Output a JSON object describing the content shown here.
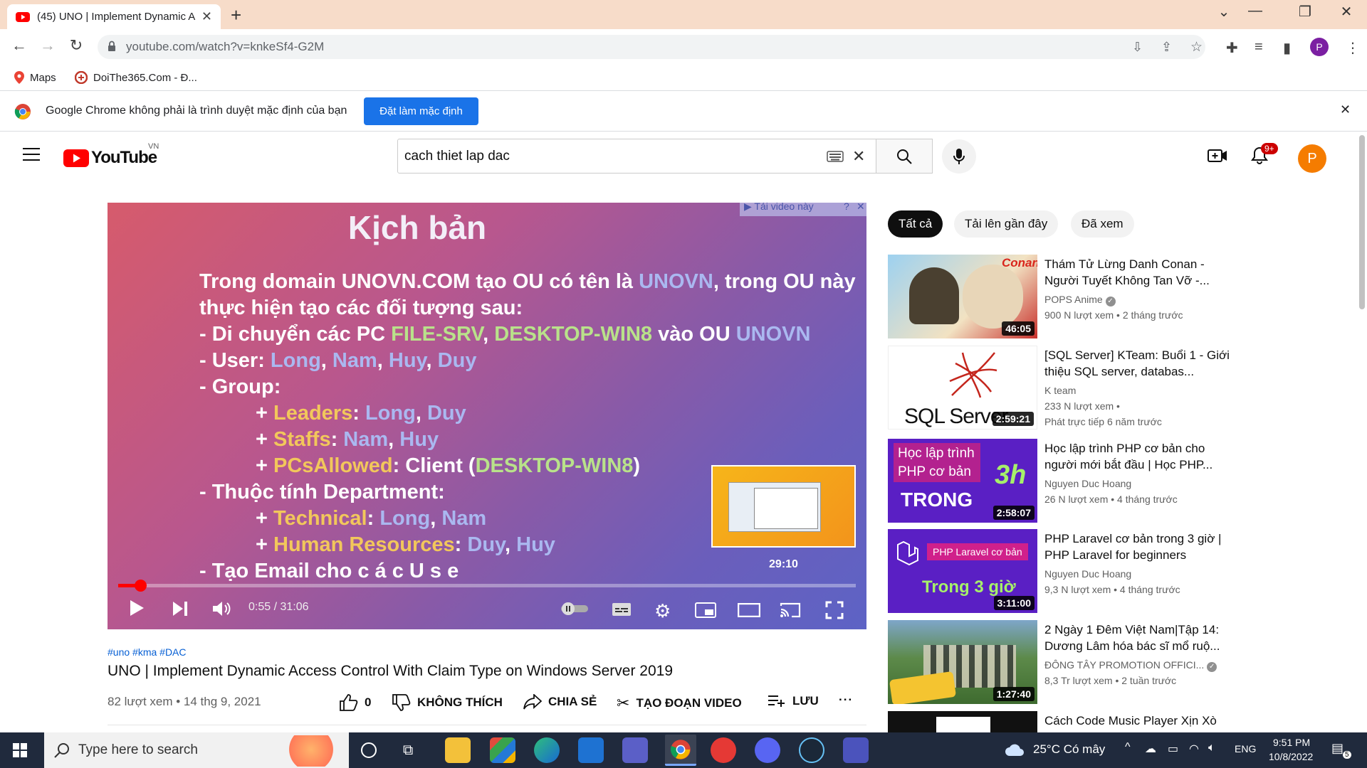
{
  "browser": {
    "tab_title": "(45) UNO | Implement Dynamic A",
    "url": "youtube.com/watch?v=knkeSf4-G2M",
    "bookmarks": [
      "Maps",
      "DoiThe365.Com - Đ..."
    ],
    "infobar_text": "Google Chrome không phải là trình duyệt mặc định của bạn",
    "infobar_button": "Đặt làm mặc định",
    "profile_initial": "P"
  },
  "youtube": {
    "logo_text": "YouTube",
    "country": "VN",
    "search_value": "cach thiet lap dac",
    "notification_count": "9+",
    "avatar_initial": "P"
  },
  "player": {
    "overlay_label": "▶ Tải video này",
    "slide_title": "Kịch bản",
    "preview_time": "29:10",
    "time": "0:55 / 31:06",
    "progress": 0.0295,
    "slide_lines": {
      "l1a": "Trong domain UNOVN.COM tạo OU có tên là ",
      "l1b": "UNOVN",
      "l1c": ", trong OU này",
      "l2": "thực hiện tạo các đối tượng sau:",
      "l3a": "- Di chuyển các PC ",
      "l3b": "FILE-SRV",
      "l3c": ", ",
      "l3d": "DESKTOP-WIN8",
      "l3e": " vào OU ",
      "l3f": "UNOVN",
      "l4a": "- User: ",
      "l4b": "Long",
      "l4c": ", ",
      "l4d": "Nam",
      "l4e": ", ",
      "l4f": "Huy",
      "l4g": ", ",
      "l4h": "Duy",
      "l5": "- Group:",
      "l6a": "+ ",
      "l6b": "Leaders",
      "l6c": ": ",
      "l6d": "Long",
      "l6e": ", ",
      "l6f": "Duy",
      "l7a": "+ ",
      "l7b": "Staffs",
      "l7c": ": ",
      "l7d": "Nam",
      "l7e": ", ",
      "l7f": "Huy",
      "l8a": "+ ",
      "l8b": "PCsAllowed",
      "l8c": ": Client (",
      "l8d": "DESKTOP-WIN8",
      "l8e": ")",
      "l9": "- Thuộc tính Department:",
      "l10a": "+ ",
      "l10b": "Technical",
      "l10c": ": ",
      "l10d": "Long",
      "l10e": ", ",
      "l10f": "Nam",
      "l11a": "+ ",
      "l11b": "Human Resources",
      "l11c": ": ",
      "l11d": "Duy",
      "l11e": ", ",
      "l11f": "Huy",
      "l12": "- Tạo Email cho c á c U s e"
    }
  },
  "video": {
    "hashtags": "#uno #kma #DAC",
    "title": "UNO | Implement Dynamic Access Control With Claim Type on Windows Server 2019",
    "meta": "82 lượt xem • 14 thg 9, 2021",
    "likes": "0",
    "dislike": "KHÔNG THÍCH",
    "share": "CHIA SẺ",
    "clip": "TẠO ĐOẠN VIDEO",
    "save": "LƯU",
    "more": "..."
  },
  "chips": [
    "Tất cả",
    "Tải lên gần đây",
    "Đã xem"
  ],
  "recommendations": [
    {
      "title": "Thám Tử Lừng Danh Conan - Người Tuyết Không Tan Vỡ -...",
      "channel": "POPS Anime",
      "verified": true,
      "stats": "900 N lượt xem • 2 tháng trước",
      "duration": "46:05",
      "thumb_text": "Conan"
    },
    {
      "title": "[SQL Server] KTeam: Buổi 1 - Giới thiệu SQL server, databas...",
      "channel": "K team",
      "verified": false,
      "stats": "233 N lượt xem •",
      "stats2": "Phát trực tiếp 6 năm trước",
      "duration": "2:59:21",
      "thumb_text": "SQL Server"
    },
    {
      "title": "Học lập trình PHP cơ bản cho người mới bắt đầu | Học PHP...",
      "channel": "Nguyen Duc Hoang",
      "verified": false,
      "stats": "26 N lượt xem • 4 tháng trước",
      "duration": "2:58:07",
      "thumb_text": "Học lập trình PHP cơ bản",
      "thumb_text2": "TRONG",
      "thumb_text3": "3h"
    },
    {
      "title": "PHP Laravel cơ bản trong 3 giờ | PHP Laravel for beginners",
      "channel": "Nguyen Duc Hoang",
      "verified": false,
      "stats": "9,3 N lượt xem • 4 tháng trước",
      "duration": "3:11:00",
      "thumb_text": "PHP Laravel cơ bản",
      "thumb_text2": "Trong 3 giờ"
    },
    {
      "title": "2 Ngày 1 Đêm Việt Nam|Tập 14: Dương Lâm hóa bác sĩ mổ ruộ...",
      "channel": "ĐÔNG TÂY PROMOTION OFFICI...",
      "verified": true,
      "stats": "8,3 Tr lượt xem • 2 tuần trước",
      "duration": "1:27:40"
    },
    {
      "title": "Cách Code Music Player Xịn Xò",
      "channel": "",
      "stats": ""
    }
  ],
  "taskbar": {
    "search_placeholder": "Type here to search",
    "weather": "25°C  Có mây",
    "lang": "ENG",
    "time": "9:51 PM",
    "date": "10/8/2022",
    "notif_count": "5"
  },
  "colors": {
    "youtube_red": "#ff0000",
    "chrome_blue": "#1a73e8",
    "tabstrip": "#f7dcc9",
    "avatar_orange": "#f57c00",
    "profile_purple": "#7b1fa2"
  }
}
